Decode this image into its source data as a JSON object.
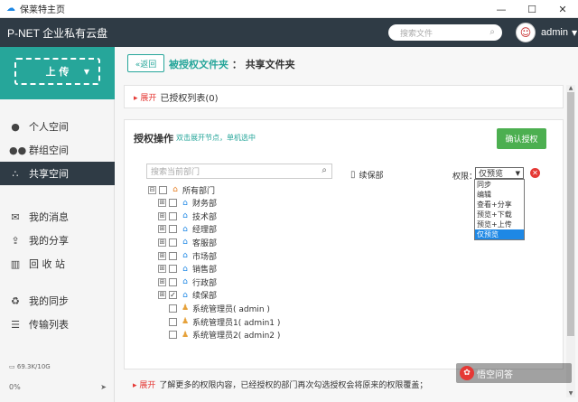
{
  "window": {
    "title": "保莱特主页",
    "controls": [
      "—",
      "☐",
      "✕"
    ]
  },
  "header": {
    "brand": "P-NET 企业私有云盘",
    "search_placeholder": "搜索文件",
    "user": "admin"
  },
  "sidebar": {
    "upload_label": "上 传",
    "nav": [
      {
        "label": "个人空间",
        "icon": "person-icon"
      },
      {
        "label": "群组空间",
        "icon": "group-icon"
      },
      {
        "label": "共享空间",
        "icon": "share-network-icon",
        "active": true
      },
      {
        "label": "我的消息",
        "icon": "message-icon"
      },
      {
        "label": "我的分享",
        "icon": "share-icon"
      },
      {
        "label": "回 收 站",
        "icon": "trash-icon"
      },
      {
        "label": "我的同步",
        "icon": "sync-icon"
      },
      {
        "label": "传输列表",
        "icon": "list-icon"
      }
    ],
    "storage": "69.3K/10G",
    "progress": "0%"
  },
  "main": {
    "back_label": "«返回",
    "crumb_link": "被授权文件夹",
    "crumb_current": "共享文件夹",
    "expand_label": "展开",
    "authorized_list": "已授权列表(0)",
    "auth_title": "授权操作",
    "auth_hint": "双击展开节点，单机选中",
    "confirm_label": "确认授权",
    "tree_search_placeholder": "搜索当前部门",
    "tree": [
      {
        "label": "所有部门",
        "type": "root",
        "toggle": "⊟",
        "indent": 0
      },
      {
        "label": "财务部",
        "type": "folder",
        "toggle": "⊞",
        "indent": 1
      },
      {
        "label": "技术部",
        "type": "folder",
        "toggle": "⊞",
        "indent": 1
      },
      {
        "label": "经理部",
        "type": "folder",
        "toggle": "⊞",
        "indent": 1
      },
      {
        "label": "客服部",
        "type": "folder",
        "toggle": "⊞",
        "indent": 1
      },
      {
        "label": "市场部",
        "type": "folder",
        "toggle": "⊞",
        "indent": 1
      },
      {
        "label": "销售部",
        "type": "folder",
        "toggle": "⊞",
        "indent": 1
      },
      {
        "label": "行政部",
        "type": "folder",
        "toggle": "⊞",
        "indent": 1
      },
      {
        "label": "续保部",
        "type": "folder",
        "toggle": "⊞",
        "indent": 1,
        "checked": true
      },
      {
        "label": "系统管理员( admin )",
        "type": "person",
        "indent": 1
      },
      {
        "label": "系统管理员1( admin1 )",
        "type": "person",
        "indent": 1
      },
      {
        "label": "系统管理员2( admin2 )",
        "type": "person",
        "indent": 1
      }
    ],
    "selected_item": "续保部",
    "perm_label": "权限：",
    "perm_value": "仅预览",
    "perm_options": [
      "同步",
      "编辑",
      "查看+分享",
      "预览+下载",
      "预览+上传",
      "仅预览"
    ],
    "footer_expand": "展开",
    "footer_text": "了解更多的权限内容，已经授权的部门再次勾选授权会将原来的权限覆盖；"
  },
  "watermark": "悟空问答"
}
